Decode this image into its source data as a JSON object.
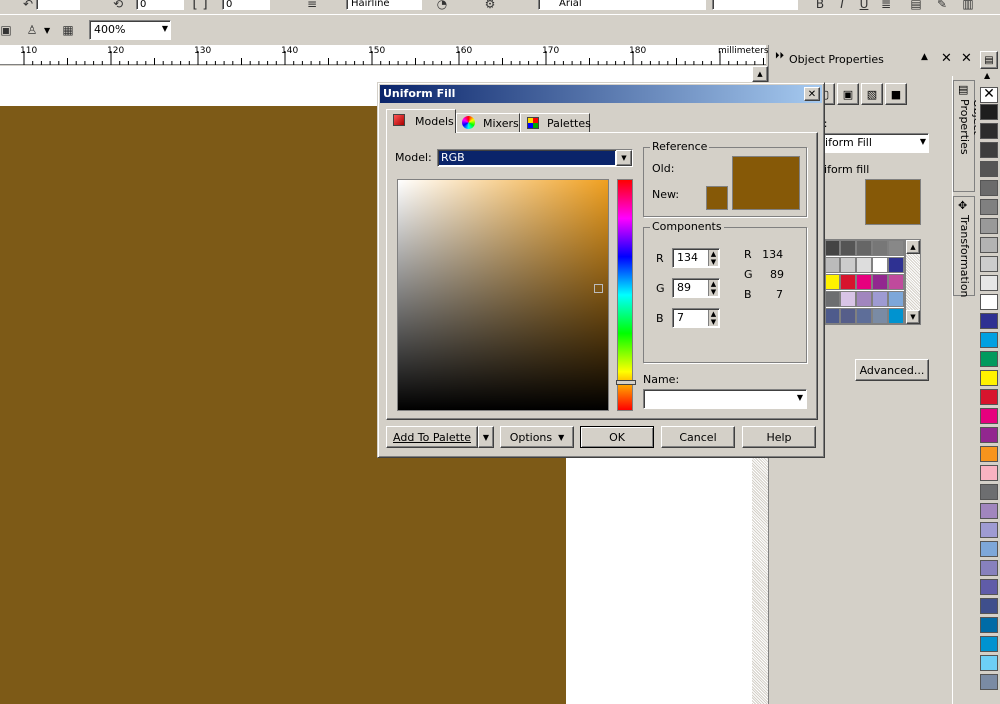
{
  "toolbar": {
    "spin_a_value": "0",
    "spin_b_value": "0",
    "style_value": "Hairline",
    "font_value": "Arial",
    "zoom_value": "400%"
  },
  "ruler": {
    "ticks": [
      "110",
      "120",
      "130",
      "140",
      "150",
      "160",
      "170",
      "180"
    ],
    "unit": "millimeters"
  },
  "docker": {
    "title": "Object Properties",
    "fill_type": "Uniform Fill",
    "fill_label": "Uniform fill",
    "advanced_label": "Advanced...",
    "tab_object_properties": "Object Properties",
    "tab_transformation": "Transformation"
  },
  "dialog": {
    "title": "Uniform Fill",
    "tabs": [
      {
        "label": "Models"
      },
      {
        "label": "Mixers"
      },
      {
        "label": "Palettes"
      }
    ],
    "model_label": "Model:",
    "model_value": "RGB",
    "reference_label": "Reference",
    "old_label": "Old:",
    "new_label": "New:",
    "components_label": "Components",
    "r_label": "R",
    "g_label": "G",
    "b_label": "B",
    "r_value": "134",
    "g_value": "89",
    "b_value": "7",
    "r_readout": "R   134",
    "g_readout": "G     89",
    "b_readout": "B       7",
    "name_label": "Name:",
    "name_value": "",
    "add_to_palette": "Add To Palette",
    "options": "Options",
    "ok": "OK",
    "cancel": "Cancel",
    "help": "Help"
  },
  "colors": {
    "fill": "#865907",
    "accent": "#0a246a"
  }
}
